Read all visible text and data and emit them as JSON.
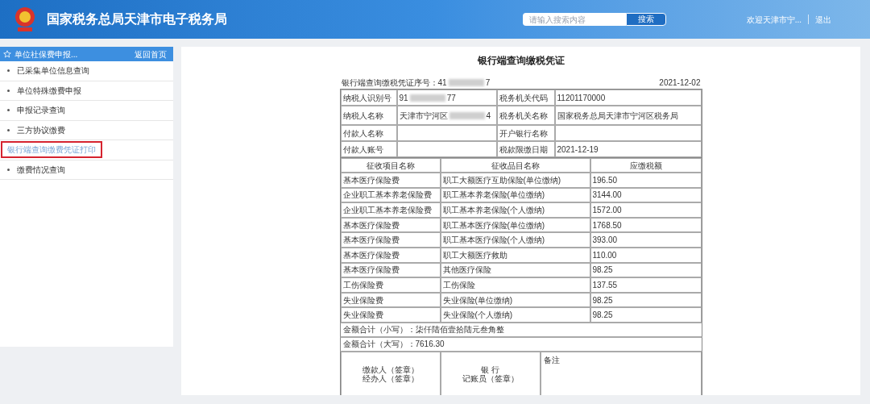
{
  "header": {
    "title": "国家税务总局天津市电子税务局",
    "search": {
      "placeholder": "请输入搜索内容",
      "button": "搜索"
    },
    "welcome": "欢迎天津市宁...",
    "logout": "退出"
  },
  "sidebar": {
    "title": "单位社保费申报...",
    "back": "返回首页",
    "items": [
      {
        "label": "已采集单位信息查询",
        "selected": false
      },
      {
        "label": "单位特殊缴费申报",
        "selected": false
      },
      {
        "label": "申报记录查询",
        "selected": false
      },
      {
        "label": "三方协议缴费",
        "selected": false
      },
      {
        "label": "银行端查询缴费凭证打印",
        "selected": true
      },
      {
        "label": "缴费情况查询",
        "selected": false
      }
    ]
  },
  "voucher": {
    "title": "银行端查询缴税凭证",
    "serial": {
      "text": "银行端查询缴税凭证序号：41",
      "tail": "7",
      "redacted": true
    },
    "date": "2021-12-02",
    "info_rows": [
      {
        "label": "纳税人识别号",
        "value": {
          "text": "91",
          "tail": "77",
          "redacted": true
        },
        "label_2": "税务机关代码",
        "value_2": "11201170000"
      },
      {
        "label": "纳税人名称",
        "value": {
          "text": "天津市宁河区",
          "tail": "4",
          "redacted": true
        },
        "label_2": "税务机关名称",
        "value_2": "国家税务总局天津市宁河区税务局"
      },
      {
        "label": "付款人名称",
        "label_2": "开户银行名称"
      },
      {
        "label": "付款人账号",
        "label_2": "税款限缴日期",
        "value_2": "2021-12-19"
      }
    ],
    "columns": [
      "征收项目名称",
      "征收品目名称",
      "应缴税额"
    ],
    "rows": [
      [
        "基本医疗保险费",
        "职工大额医疗互助保险(单位缴纳)",
        "196.50"
      ],
      [
        "企业职工基本养老保险费",
        "职工基本养老保险(单位缴纳)",
        "3144.00"
      ],
      [
        "企业职工基本养老保险费",
        "职工基本养老保险(个人缴纳)",
        "1572.00"
      ],
      [
        "基本医疗保险费",
        "职工基本医疗保险(单位缴纳)",
        "1768.50"
      ],
      [
        "基本医疗保险费",
        "职工基本医疗保险(个人缴纳)",
        "393.00"
      ],
      [
        "基本医疗保险费",
        "职工大额医疗救助",
        "110.00"
      ],
      [
        "基本医疗保险费",
        "其他医疗保险",
        "98.25"
      ],
      [
        "工伤保险费",
        "工伤保险",
        "137.55"
      ],
      [
        "失业保险费",
        "失业保险(单位缴纳)",
        "98.25"
      ],
      [
        "失业保险费",
        "失业保险(个人缴纳)",
        "98.25"
      ]
    ],
    "totals": [
      "金额合计（小写）：柒仟陆佰壹拾陆元叁角整",
      "金额合计（大写）：7616.30"
    ],
    "signature": {
      "payer": [
        "缴款人（签章）",
        "经办人（签章）"
      ],
      "bank": [
        "银 行",
        "记账员（签章）"
      ],
      "remarks": "备注"
    }
  }
}
